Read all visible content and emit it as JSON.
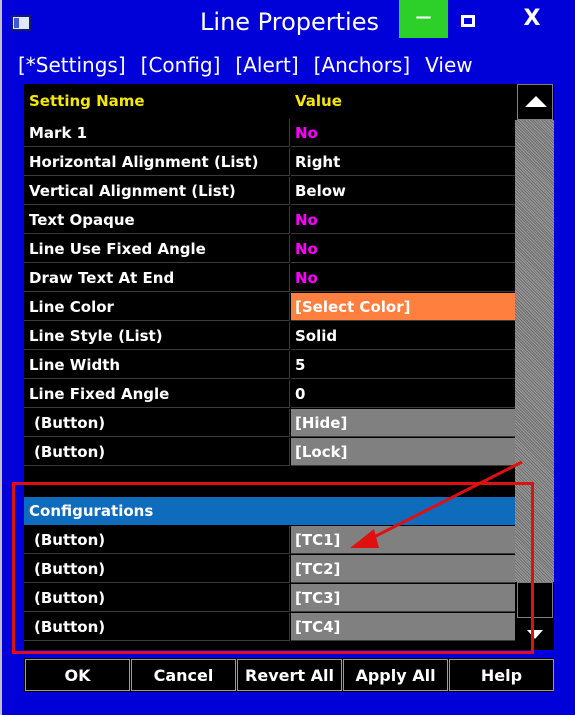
{
  "window": {
    "title": "Line Properties",
    "minimize_label": "—",
    "close_label": "X"
  },
  "menu": [
    "[*Settings]",
    "[Config]",
    "[Alert]",
    "[Anchors]",
    "View"
  ],
  "grid": {
    "header": {
      "name": "Setting Name",
      "value": "Value"
    },
    "rows": [
      {
        "name": "Mark 1",
        "value": "No"
      },
      {
        "name": "Horizontal Alignment (List)",
        "value": "Right"
      },
      {
        "name": "Vertical Alignment (List)",
        "value": "Below"
      },
      {
        "name": "Text Opaque",
        "value": "No"
      },
      {
        "name": "Line Use Fixed Angle",
        "value": "No"
      },
      {
        "name": "Draw Text At End",
        "value": "No"
      },
      {
        "name": "Line Color",
        "value": "[Select Color]"
      },
      {
        "name": "Line Style (List)",
        "value": "Solid"
      },
      {
        "name": "Line Width",
        "value": "5"
      },
      {
        "name": "Line Fixed Angle",
        "value": "0"
      },
      {
        "name": "(Button)",
        "value": "[Hide]"
      },
      {
        "name": "(Button)",
        "value": "[Lock]"
      }
    ],
    "section": "Configurations",
    "config_rows": [
      {
        "name": "(Button)",
        "value": "[TC1]"
      },
      {
        "name": "(Button)",
        "value": "[TC2]"
      },
      {
        "name": "(Button)",
        "value": "[TC3]"
      },
      {
        "name": "(Button)",
        "value": "[TC4]"
      }
    ]
  },
  "buttons": [
    "OK",
    "Cancel",
    "Revert All",
    "Apply All",
    "Help"
  ],
  "colors": {
    "window_bg": "#0000d8",
    "header_text": "#f5e800",
    "no_value": "#ff00ff",
    "line_color_swatch": "#ff7f3f",
    "section_bg": "#0f6bbb",
    "annotation": "#e01010"
  }
}
